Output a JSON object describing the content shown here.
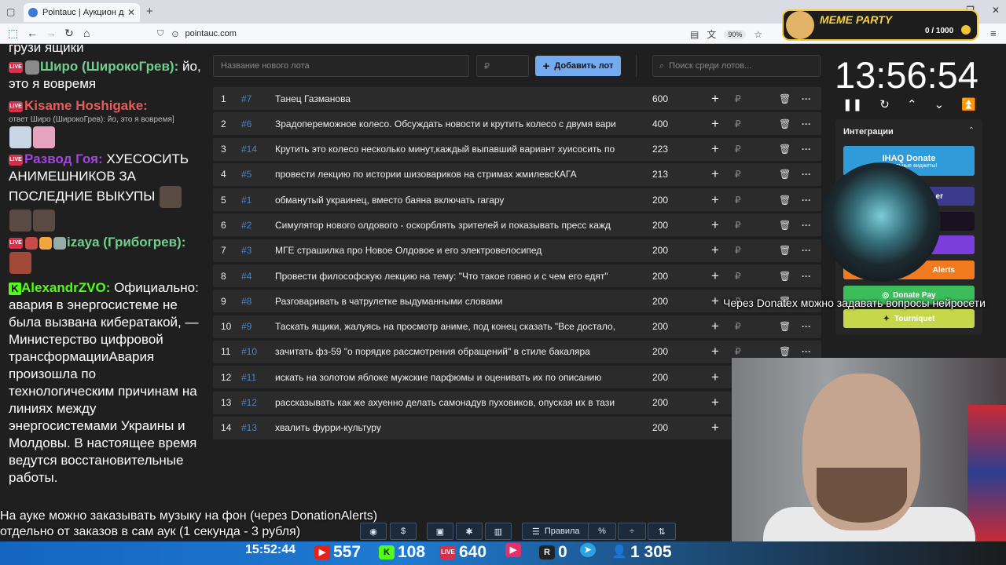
{
  "browser": {
    "tab_title": "Pointauc | Аукцион для стримеров",
    "url": "pointauc.com",
    "zoom": "90%"
  },
  "chat": {
    "messages": [
      {
        "text": "грузи ящики"
      },
      {
        "nick": "Широ (ШирокоГрев):",
        "nick_color": "#6fd08c",
        "text": " йо, это я вовремя"
      },
      {
        "nick": "Kisame Hoshigake:",
        "nick_color": "#e85c5c",
        "reply": "ответ Широ (ШирокоГрев): йо, это я вовремя]"
      },
      {
        "nick": "Развод Гоя:",
        "nick_color": "#a642e6",
        "text": " ХУЕСОСИТЬ АНИМЕШНИКОВ ЗА ПОСЛЕДНИЕ ВЫКУПЫ"
      },
      {
        "nick": "izaya (Грибогрев):",
        "nick_color": "#6fd08c",
        "text": ""
      },
      {
        "nick": "AlexandrZVO:",
        "nick_color": "#53fc18",
        "text": " Официально: авария в энергосистеме не была вызвана кибератакой, — Министерство цифровой трансформацииАвария произошла по технологическим причинам на линиях между энергосистемами Украины и Молдовы. В настоящее время ведутся восстановительные работы."
      }
    ]
  },
  "controls": {
    "lot_name_placeholder": "Название нового лота",
    "price_placeholder": "₽",
    "add_lot_label": "Добавить лот",
    "search_placeholder": "Поиск среди лотов..."
  },
  "lots": [
    {
      "idx": "1",
      "id": "#7",
      "name": "Танец Газманова",
      "amount": "600",
      "actions": true
    },
    {
      "idx": "2",
      "id": "#6",
      "name": "Зрадопереможное колесо. Обсуждать новости и крутить колесо с двумя вари",
      "amount": "400",
      "actions": true
    },
    {
      "idx": "3",
      "id": "#14",
      "name": "Крутить это колесо несколько минут,каждый выпавший вариант хуисосить по",
      "amount": "223",
      "actions": true
    },
    {
      "idx": "4",
      "id": "#5",
      "name": "провести лекцию по истории шизовариков на стримах жмилевсКАГА",
      "amount": "213",
      "actions": true
    },
    {
      "idx": "5",
      "id": "#1",
      "name": "обманутый украинец, вместо баяна включать гагару",
      "amount": "200",
      "actions": true
    },
    {
      "idx": "6",
      "id": "#2",
      "name": "Симулятор нового олдового - оскорблять зрителей и показывать пресс кажд",
      "amount": "200",
      "actions": true
    },
    {
      "idx": "7",
      "id": "#3",
      "name": " МГЕ страшилка про Новое Олдовое и его электровелосипед",
      "amount": "200",
      "actions": true
    },
    {
      "idx": "8",
      "id": "#4",
      "name": "Провести философскую лекцию на тему: \"Что такое говно и с чем его едят\"",
      "amount": "200",
      "actions": true
    },
    {
      "idx": "9",
      "id": "#8",
      "name": "Разговаривать в чатрулетке выдуманными словами",
      "amount": "200",
      "actions": true
    },
    {
      "idx": "10",
      "id": "#9",
      "name": "Таскать ящики, жалуясь на просмотр аниме, под конец сказать \"Все достало,",
      "amount": "200",
      "actions": true
    },
    {
      "idx": "11",
      "id": "#10",
      "name": "зачитать фз-59 \"о порядке рассмотрения обращений\" в стиле бакаляра",
      "amount": "200",
      "actions": true
    },
    {
      "idx": "12",
      "id": "#11",
      "name": " искать на золотом яблоке мужские парфюмы и оценивать их по описанию",
      "amount": "200",
      "actions": false
    },
    {
      "idx": "13",
      "id": "#12",
      "name": "рассказывать как же ахуенно делать самонадув пуховиков, опуская их в тази",
      "amount": "200",
      "actions": false
    },
    {
      "idx": "14",
      "id": "#13",
      "name": "хвалить фурри-культуру",
      "amount": "200",
      "actions": false
    }
  ],
  "timer": {
    "value": "13:56:54"
  },
  "integrations": {
    "title": "Интеграции",
    "ihaq_label": "IHAQ Donate",
    "ihaq_sub": "Уникальные виджеты!",
    "partial_1": "er",
    "alerts_label": "Alerts",
    "donatepay_label": "Donate Pay",
    "tourniquet_label": "Tourniquet"
  },
  "overlay": {
    "donatex": "Через Donatex можно задавать вопросы нейросети",
    "announcement_1": "На ауке можно заказывать музыку на фон (через DonationAlerts)",
    "announcement_2": "отдельно от заказов в сам аук (1 секунда - 3 рубля)"
  },
  "toolbar": {
    "rules_label": "Правила"
  },
  "stats": {
    "time": "15:52:44",
    "youtube": "557",
    "kick": "108",
    "live": "640",
    "rumble": "0",
    "viewers": "1 305"
  },
  "meme_party": {
    "title": "MEME PARTY",
    "count": "0 / 1000"
  },
  "colors": {
    "accent": "#74abf0",
    "ihaq": "#2f9bd9",
    "donatepay": "#3cbd5c",
    "alerts": "#f17b1e",
    "tourniquet": "#c6d84a"
  }
}
